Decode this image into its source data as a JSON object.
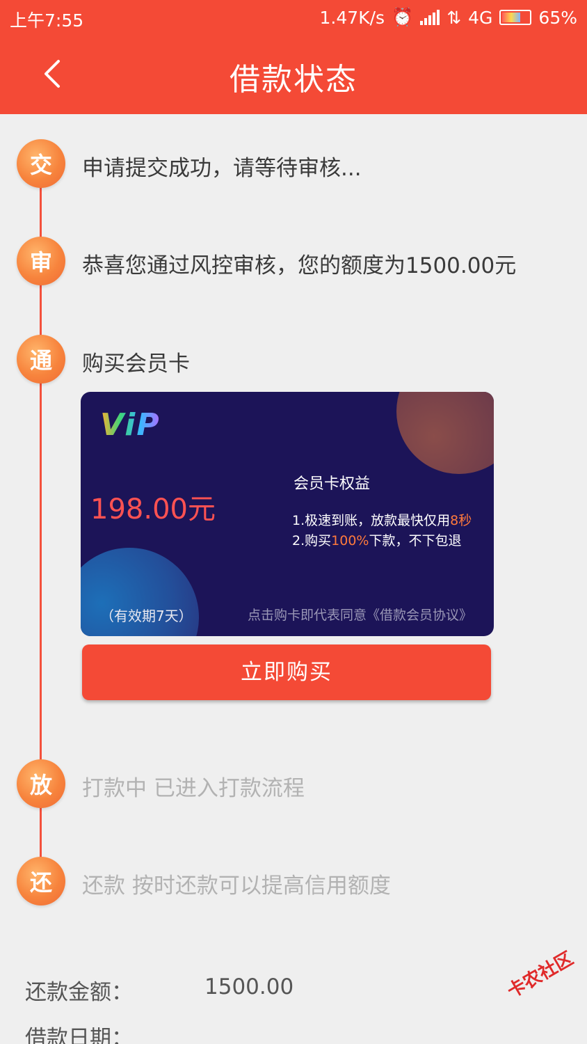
{
  "status_bar": {
    "time": "上午7:55",
    "speed": "1.47K/s",
    "network": "4G",
    "battery": "65%"
  },
  "header": {
    "title": "借款状态"
  },
  "steps": [
    {
      "icon_char": "交",
      "text": "申请提交成功，请等待审核..."
    },
    {
      "icon_char": "审",
      "text": "恭喜您通过风控审核，您的额度为1500.00元"
    },
    {
      "icon_char": "通",
      "text": "购买会员卡"
    },
    {
      "icon_char": "放",
      "text": "打款中 已进入打款流程"
    },
    {
      "icon_char": "还",
      "text": "还款 按时还款可以提高信用额度"
    }
  ],
  "vip_card": {
    "logo": "ViP",
    "price": "198.00元",
    "validity": "（有效期7天）",
    "benefits_title": "会员卡权益",
    "benefit1_prefix": "1.极速到账，放款最快仅用",
    "benefit1_highlight": "8秒",
    "benefit2_prefix": "2.购买",
    "benefit2_highlight": "100%",
    "benefit2_suffix": "下款，不下包退",
    "agreement": "点击购卡即代表同意《借款会员协议》"
  },
  "buy_button": "立即购买",
  "info": {
    "repay_amount_label": "还款金额：",
    "repay_amount_value": "1500.00",
    "loan_date_label": "借款日期："
  },
  "watermark": "卡农社区",
  "colors": {
    "brand_red": "#f44a36",
    "step_orange": "#f7843d",
    "card_bg": "#1c1458",
    "highlight_orange": "#ff7a3c",
    "price_red": "#ff5252"
  }
}
